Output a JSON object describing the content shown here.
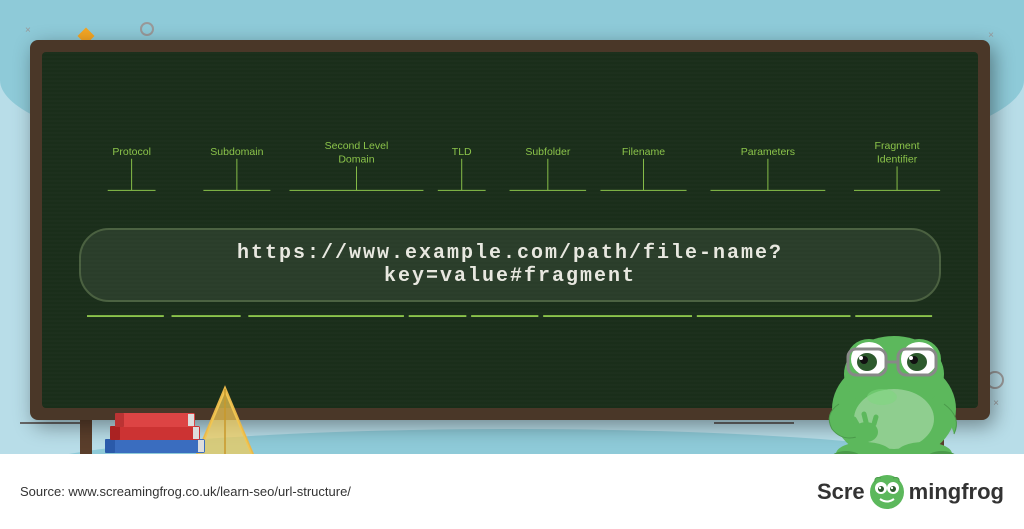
{
  "background": {
    "color": "#b8dde8"
  },
  "blackboard": {
    "url": "https://www.example.com/path/file-name?key=value#fragment",
    "labels": [
      {
        "id": "protocol",
        "text": "Protocol",
        "lines": 1
      },
      {
        "id": "subdomain",
        "text": "Subdomain",
        "lines": 1
      },
      {
        "id": "second-level-domain",
        "text": "Second Level\nDomain",
        "lines": 2
      },
      {
        "id": "tld",
        "text": "TLD",
        "lines": 1
      },
      {
        "id": "subfolder",
        "text": "Subfolder",
        "lines": 1
      },
      {
        "id": "filename",
        "text": "Filename",
        "lines": 1
      },
      {
        "id": "parameters",
        "text": "Parameters",
        "lines": 1
      },
      {
        "id": "fragment-identifier",
        "text": "Fragment\nIdentifier",
        "lines": 2
      }
    ]
  },
  "bottom_bar": {
    "source_prefix": "Source: ",
    "source_url": "www.screamingfrog.co.uk/learn-seo/url-structure/",
    "logo_text_left": "Scre",
    "logo_text_right": "mingfrog"
  },
  "decorations": {
    "diamond_color": "#f5a623",
    "square_color": "#4a90d9",
    "red_square_color": "#cc3333"
  }
}
